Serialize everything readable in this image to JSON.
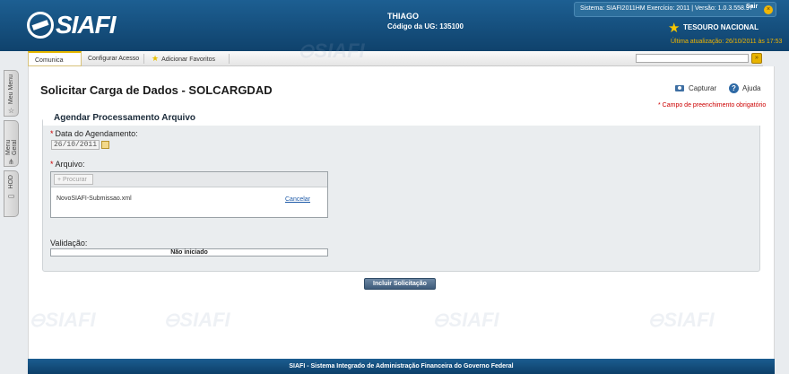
{
  "header": {
    "logo_text": "SIAFI",
    "user_name": "THIAGO",
    "ug_label": "Código da UG:",
    "ug_value": "135100",
    "system_info": "Sistema: SIAFI2011HM Exercício: 2011 | Versão: 1.0.3.558.97",
    "logout_label": "Sair",
    "tesouro_label": "TESOURO NACIONAL",
    "last_update": "Última atualização: 26/10/2011 às 17:53"
  },
  "tabs": {
    "comunica": "Comunica",
    "configurar": "Configurar Acesso",
    "favoritos": "Adicionar Favoritos"
  },
  "search": {
    "value": "",
    "go_label": "»"
  },
  "left_rail": {
    "items": [
      {
        "label": "Meu Menu",
        "icon": "star-icon"
      },
      {
        "label": "Menu Geral",
        "icon": "tree-icon"
      },
      {
        "label": "HOD",
        "icon": "monitor-icon"
      }
    ]
  },
  "page": {
    "title": "Solicitar Carga de Dados - SOLCARGDAD",
    "capturar_label": "Capturar",
    "ajuda_label": "Ajuda",
    "required_note": "* Campo de preenchimento obrigatório"
  },
  "form": {
    "legend": "Agendar Processamento Arquivo",
    "date_label": "Data do Agendamento:",
    "date_value": "26/10/2011",
    "file_label": "Arquivo:",
    "browse_label": "Procurar",
    "file_name": "NovoSIAFI-Submissao.xml",
    "cancel_label": "Cancelar",
    "validation_label": "Validação:",
    "validation_status": "Não iniciado",
    "validation_progress": 0,
    "submit_label": "Incluir Solicitação"
  },
  "footer": {
    "text": "SIAFI - Sistema Integrado de Administração Financeira do Governo Federal"
  },
  "colors": {
    "header_blue": "#1d5f92",
    "accent_gold": "#e8b400",
    "required_red": "#cc0000"
  }
}
